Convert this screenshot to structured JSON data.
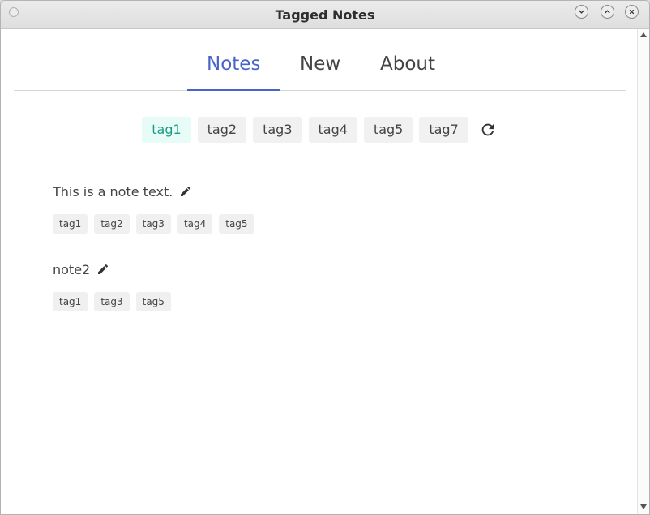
{
  "window": {
    "title": "Tagged Notes"
  },
  "tabs": [
    {
      "label": "Notes",
      "active": true
    },
    {
      "label": "New",
      "active": false
    },
    {
      "label": "About",
      "active": false
    }
  ],
  "filter_tags": [
    {
      "label": "tag1",
      "selected": true
    },
    {
      "label": "tag2",
      "selected": false
    },
    {
      "label": "tag3",
      "selected": false
    },
    {
      "label": "tag4",
      "selected": false
    },
    {
      "label": "tag5",
      "selected": false
    },
    {
      "label": "tag7",
      "selected": false
    }
  ],
  "notes": [
    {
      "text": "This is a note text.",
      "tags": [
        "tag1",
        "tag2",
        "tag3",
        "tag4",
        "tag5"
      ]
    },
    {
      "text": "note2",
      "tags": [
        "tag1",
        "tag3",
        "tag5"
      ]
    }
  ],
  "colors": {
    "accent": "#4a63c9",
    "selected_tag_bg": "#e7fbf7",
    "selected_tag_text": "#1a9c86"
  },
  "icons": {
    "refresh": "refresh-icon",
    "edit": "pencil-icon",
    "minimize": "chevron-down-icon",
    "maximize": "chevron-up-icon",
    "close": "close-icon"
  }
}
